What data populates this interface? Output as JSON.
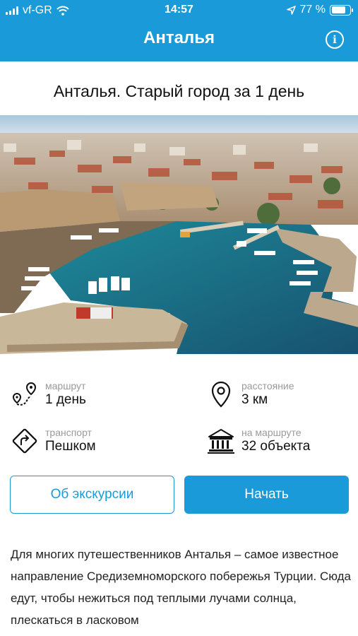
{
  "status_bar": {
    "carrier": "vf-GR",
    "time": "14:57",
    "battery": "77 %",
    "battery_level": 0.77
  },
  "nav": {
    "title": "Анталья",
    "info_icon": "info-icon"
  },
  "tour": {
    "title": "Анталья. Старый город за 1 день"
  },
  "details": {
    "route_label": "маршрут",
    "route_value": "1 день",
    "distance_label": "расстояние",
    "distance_value": "3 км",
    "transport_label": "транспорт",
    "transport_value": "Пешком",
    "objects_label": "на маршруте",
    "objects_value": "32 объекта"
  },
  "actions": {
    "about_label": "Об экскурсии",
    "start_label": "Начать"
  },
  "description": "Для многих путешественников Анталья – самое известное направление Средиземноморского побережья Турции. Сюда едут, чтобы нежиться под теплыми лучами солнца, плескаться в ласковом",
  "colors": {
    "accent": "#1a9ad9"
  }
}
